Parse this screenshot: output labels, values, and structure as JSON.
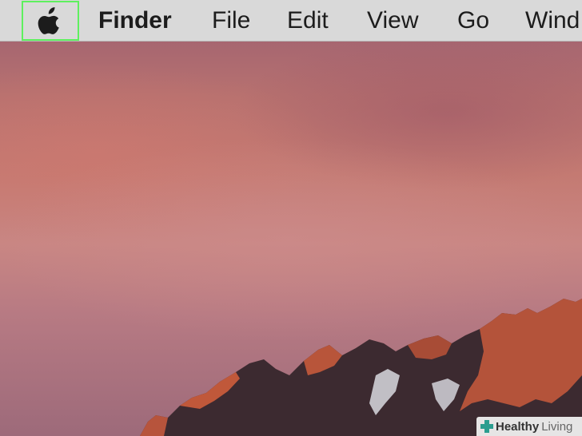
{
  "menubar": {
    "apple_icon": "apple-logo",
    "highlight_color": "#5ef05e",
    "items": [
      {
        "label": "Finder",
        "bold": true
      },
      {
        "label": "File"
      },
      {
        "label": "Edit"
      },
      {
        "label": "View"
      },
      {
        "label": "Go"
      },
      {
        "label": "Wind"
      }
    ]
  },
  "watermark": {
    "icon": "plus-cross-icon",
    "label_bold": "Healthy",
    "label_light": "Living"
  }
}
